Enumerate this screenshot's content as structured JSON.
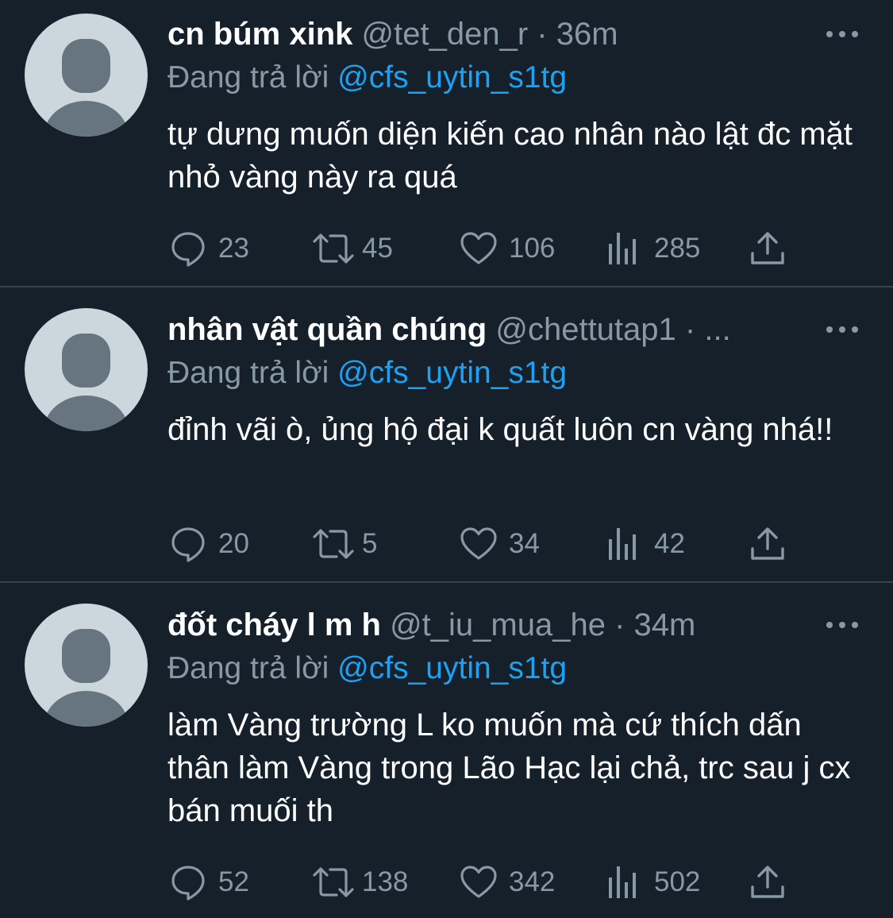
{
  "replies": [
    {
      "display_name": "cn búm xink",
      "handle": "@tet_den_r",
      "separator": "·",
      "time": "36m",
      "replying_prefix": "Đang trả lời",
      "replying_to": "@cfs_uytin_s1tg",
      "text": "tự dưng muốn diện kiến cao nhân nào lật đc mặt nhỏ vàng này ra quá",
      "stats": {
        "replies": "23",
        "retweets": "45",
        "likes": "106",
        "views": "285"
      }
    },
    {
      "display_name": "nhân vật quần chúng",
      "handle": "@chettutap1",
      "separator": "·",
      "time": "...",
      "replying_prefix": "Đang trả lời",
      "replying_to": "@cfs_uytin_s1tg",
      "text": "đỉnh vãi ò, ủng hộ đại k quất luôn cn vàng nhá!!",
      "stats": {
        "replies": "20",
        "retweets": "5",
        "likes": "34",
        "views": "42"
      }
    },
    {
      "display_name": "đốt cháy l m h",
      "handle": "@t_iu_mua_he",
      "separator": "·",
      "time": "34m",
      "replying_prefix": "Đang trả lời",
      "replying_to": "@cfs_uytin_s1tg",
      "text": "làm Vàng trường L ko muốn mà cứ thích dấn thân làm Vàng trong Lão Hạc lại chả, trc sau j cx bán muối th",
      "stats": {
        "replies": "52",
        "retweets": "138",
        "likes": "342",
        "views": "502"
      }
    }
  ],
  "icons": {
    "avatar": "default-avatar-icon",
    "more": "more-dots-icon",
    "reply": "reply-bubble-icon",
    "retweet": "retweet-icon",
    "like": "heart-icon",
    "views": "views-bar-chart-icon",
    "share": "share-upload-icon"
  },
  "colors": {
    "background": "#15202b",
    "text": "#ffffff",
    "secondary_text": "#8899a6",
    "mention": "#1da1f2",
    "divider": "#38444d"
  }
}
